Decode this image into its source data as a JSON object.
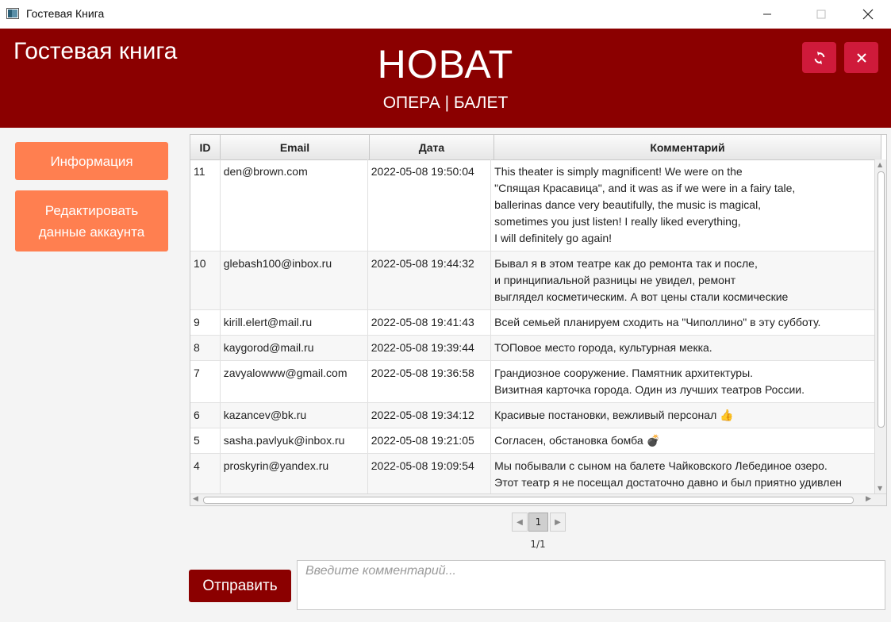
{
  "window": {
    "title": "Гостевая Книга"
  },
  "header": {
    "app_heading": "Гостевая книга",
    "brand_title": "НОВАТ",
    "brand_subtitle": "ОПЕРА | БАЛЕТ",
    "accent_color": "#8b0000",
    "action_button_color": "#cf1a3a"
  },
  "sidebar": {
    "info_button": "Информация",
    "edit_button_line1": "Редактировать",
    "edit_button_line2": "данные аккаунта",
    "button_color": "#ff7f50"
  },
  "table": {
    "columns": [
      "ID",
      "Email",
      "Дата",
      "Комментарий"
    ],
    "rows": [
      {
        "id": "11",
        "email": "den@brown.com",
        "date": "2022-05-08 19:50:04",
        "comment": "This theater is simply magnificent! We were on the\n\"Спящая Красавица\", and it was as if we were in a fairy tale,\nballerinas dance very beautifully, the music is magical,\nsometimes you just listen! I really liked everything,\nI will definitely go again!"
      },
      {
        "id": "10",
        "email": "glebash100@inbox.ru",
        "date": "2022-05-08 19:44:32",
        "comment": "Бывал я в этом театре как до ремонта так и после,\nи принципиальной разницы не увидел, ремонт\nвыглядел косметическим. А вот цены стали космические"
      },
      {
        "id": "9",
        "email": "kirill.elert@mail.ru",
        "date": "2022-05-08 19:41:43",
        "comment": "Всей семьей планируем сходить на \"Чиполлино\" в эту субботу."
      },
      {
        "id": "8",
        "email": "kaygorod@mail.ru",
        "date": "2022-05-08 19:39:44",
        "comment": "ТОПовое место города, культурная мекка."
      },
      {
        "id": "7",
        "email": "zavyalowww@gmail.com",
        "date": "2022-05-08 19:36:58",
        "comment": "Грандиозное сооружение. Памятник архитектуры.\nВизитная карточка города. Один из лучших театров России."
      },
      {
        "id": "6",
        "email": "kazancev@bk.ru",
        "date": "2022-05-08 19:34:12",
        "comment": "Красивые постановки, вежливый персонал 👍"
      },
      {
        "id": "5",
        "email": "sasha.pavlyuk@inbox.ru",
        "date": "2022-05-08 19:21:05",
        "comment": "Согласен, обстановка бомба 💣"
      },
      {
        "id": "4",
        "email": "proskyrin@yandex.ru",
        "date": "2022-05-08 19:09:54",
        "comment": "Мы побывали с сыном на балете Чайковского Лебединое озеро.\nЭтот театр я не посещал достаточно давно и был приятно удивлен\n-прекрасный ремонт, замечательная обстановка, ковры,"
      }
    ]
  },
  "pagination": {
    "current_page": "1",
    "info": "1/1"
  },
  "composer": {
    "send_label": "Отправить",
    "placeholder": "Введите комментарий..."
  }
}
